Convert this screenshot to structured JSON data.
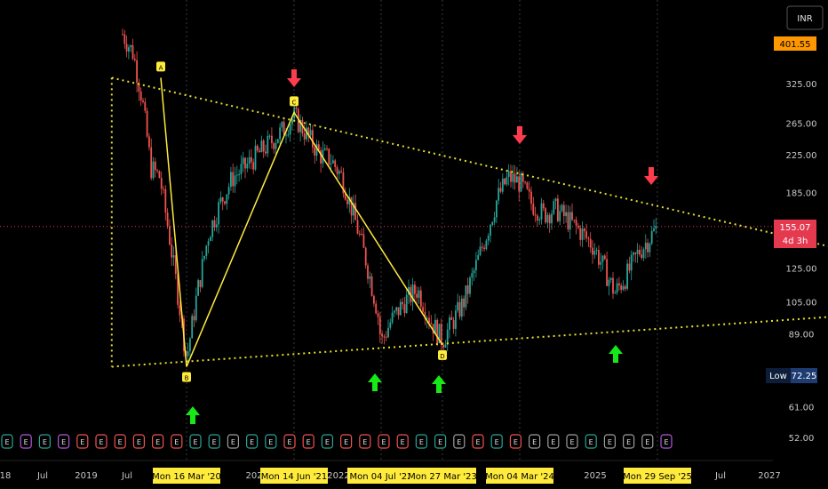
{
  "app": {
    "currency": "INR",
    "top_price": "401.55",
    "current_price": "155.07",
    "countdown": "4d 3h",
    "low_label": "Low",
    "low_value": "72.25"
  },
  "colors": {
    "background": "#000000",
    "up": "#26a69a",
    "down": "#ef5350",
    "pattern": "#ffeb3b",
    "trendline": "#e6e02a",
    "arrow_down": "#ff3b4e",
    "arrow_up": "#17e817",
    "price_badge": "#ff9800",
    "current_badge": "#e53950",
    "date_badge": "#ffeb3b"
  },
  "chart_data": {
    "type": "candlestick",
    "y_scale": "log",
    "ylim": [
      48,
      430
    ],
    "y_ticks": [
      "325.00",
      "265.00",
      "225.00",
      "185.00",
      "125.00",
      "105.00",
      "89.00",
      "61.00",
      "52.00"
    ],
    "y_tick_values": [
      325,
      265,
      225,
      185,
      125,
      105,
      89,
      61,
      52
    ],
    "x_ticks": [
      "18",
      "Jul",
      "2019",
      "Jul",
      "202",
      "2022",
      "2025",
      "Jul",
      "2027"
    ],
    "highlighted_dates": [
      "Mon 16 Mar '20",
      "Mon 14 Jun '21",
      "Mon 04 Jul '22",
      "Mon 27 Mar '23",
      "Mon 04 Mar '24",
      "Mon 29 Sep '25"
    ],
    "pattern_points": [
      {
        "label": "A",
        "date": "2019-08",
        "value": 335
      },
      {
        "label": "B",
        "date": "2020-03",
        "value": 75
      },
      {
        "label": "C",
        "date": "2021-06",
        "value": 280
      },
      {
        "label": "D",
        "date": "2023-03",
        "value": 84
      }
    ],
    "trendlines": [
      {
        "name": "upper",
        "from": {
          "date": "2019-08",
          "value": 335
        },
        "to": {
          "date": "2027-02",
          "value": 140
        }
      },
      {
        "name": "lower",
        "from": {
          "date": "2019-08",
          "value": 75
        },
        "to": {
          "date": "2027-02",
          "value": 97
        }
      }
    ],
    "current_price": 155.07,
    "low": 72.25,
    "earnings_markers": [
      "E",
      "E",
      "E",
      "E",
      "E",
      "E",
      "E",
      "E",
      "E",
      "E",
      "E",
      "E",
      "E",
      "E",
      "E",
      "E",
      "E",
      "E",
      "E",
      "E",
      "E",
      "E",
      "E",
      "E",
      "E",
      "E",
      "E",
      "E",
      "E",
      "E",
      "E",
      "E",
      "E",
      "E",
      "E",
      "E"
    ],
    "earnings_colors": [
      "teal",
      "purple",
      "teal",
      "purple",
      "red",
      "red",
      "red",
      "red",
      "red",
      "red",
      "teal",
      "teal",
      "grey",
      "teal",
      "teal",
      "red",
      "red",
      "teal",
      "red",
      "red",
      "red",
      "red",
      "teal",
      "teal",
      "grey",
      "red",
      "teal",
      "red",
      "grey",
      "grey",
      "grey",
      "teal",
      "grey",
      "grey",
      "grey",
      "purple"
    ],
    "arrows": [
      {
        "dir": "up",
        "date": "2020-03"
      },
      {
        "dir": "down",
        "date": "2021-06"
      },
      {
        "dir": "up",
        "date": "2022-07"
      },
      {
        "dir": "up",
        "date": "2023-03"
      },
      {
        "dir": "down",
        "date": "2024-03"
      },
      {
        "dir": "up",
        "date": "2025-03"
      },
      {
        "dir": "down",
        "date": "2025-09"
      }
    ]
  }
}
